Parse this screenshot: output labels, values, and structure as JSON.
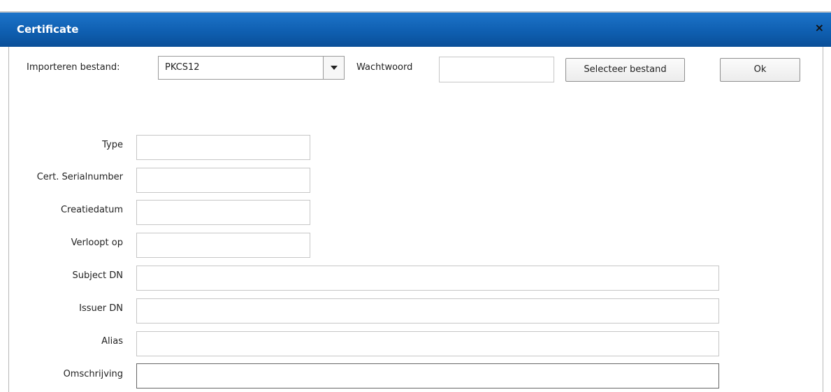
{
  "window": {
    "title": "Certificate",
    "close_glyph": "×"
  },
  "toolbar": {
    "import_label": "Importeren bestand:",
    "import_type": {
      "selected": "PKCS12"
    },
    "password_label": "Wachtwoord",
    "password_value": "",
    "select_file_label": "Selecteer bestand",
    "ok_label": "Ok"
  },
  "form": {
    "fields": [
      {
        "label": "Type",
        "value": ""
      },
      {
        "label": "Cert. Serialnumber",
        "value": ""
      },
      {
        "label": "Creatiedatum",
        "value": ""
      },
      {
        "label": "Verloopt op",
        "value": ""
      },
      {
        "label": "Subject DN",
        "value": ""
      },
      {
        "label": "Issuer DN",
        "value": ""
      },
      {
        "label": "Alias",
        "value": ""
      },
      {
        "label": "Omschrijving",
        "value": ""
      }
    ]
  },
  "colors": {
    "titlebar": "#0f5fb1",
    "title_text": "#ffffff"
  }
}
